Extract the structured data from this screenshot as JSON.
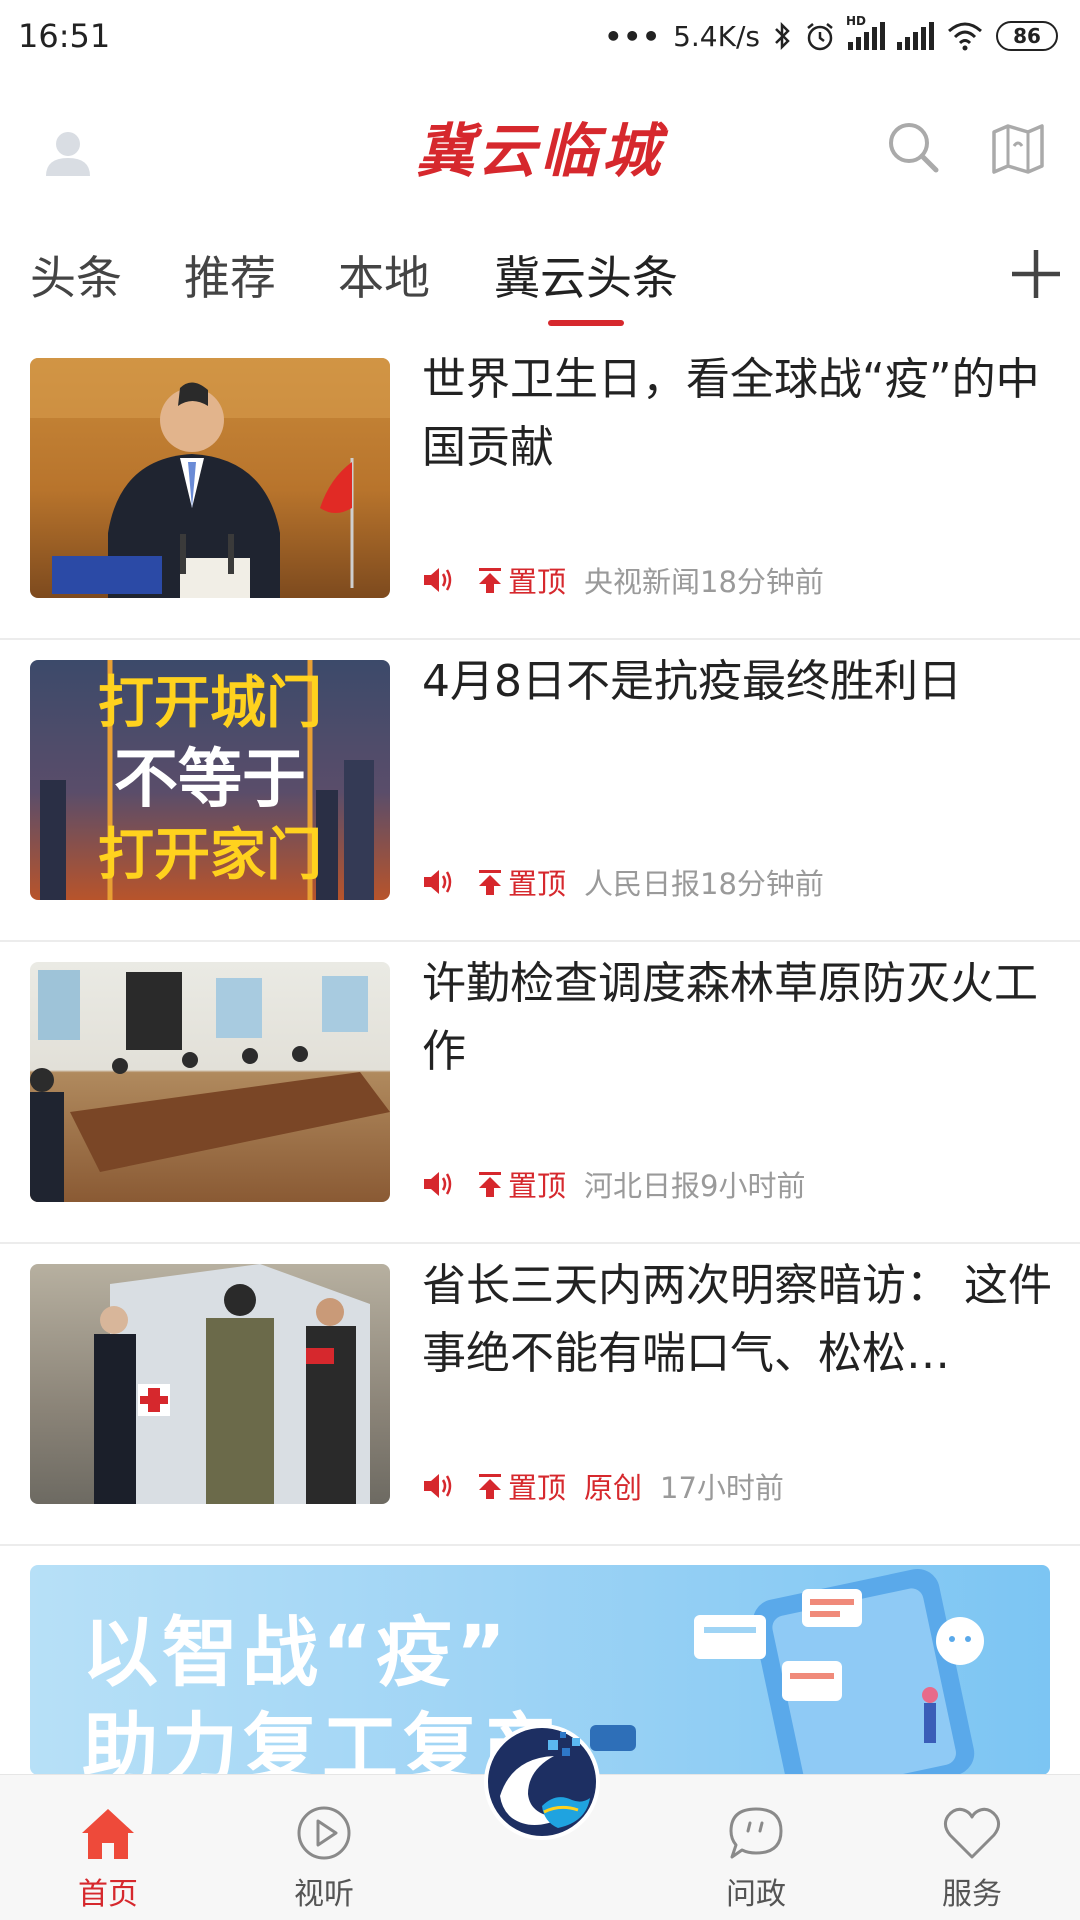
{
  "status_bar": {
    "time": "16:51",
    "network_speed": "5.4K/s",
    "hd_label": "HD",
    "battery": "86",
    "icons": [
      "dots-icon",
      "bluetooth-icon",
      "alarm-icon",
      "signal-icon",
      "signal-icon",
      "wifi-icon",
      "battery-icon"
    ]
  },
  "header": {
    "title": "冀云临城",
    "left_icon": "avatar-icon",
    "right_icons": [
      "search-icon",
      "map-icon"
    ]
  },
  "tabs": {
    "items": [
      {
        "label": "头条"
      },
      {
        "label": "推荐"
      },
      {
        "label": "本地"
      },
      {
        "label": "冀云头条"
      }
    ],
    "active_index": 3,
    "add_icon": "plus-icon"
  },
  "news": [
    {
      "title": "世界卫生日，看全球战“疫”的中国贡献",
      "pin_label": "置顶",
      "tag": "",
      "source": "央视新闻18分钟前"
    },
    {
      "title": "4月8日不是抗疫最终胜利日",
      "pin_label": "置顶",
      "tag": "",
      "source": "人民日报18分钟前",
      "image_text": [
        "打开城门",
        "不等于",
        "打开家门"
      ]
    },
    {
      "title": "许勤检查调度森林草原防灭火工作",
      "pin_label": "置顶",
      "tag": "",
      "source": "河北日报9小时前"
    },
    {
      "title": "省长三天内两次明察暗访： 这件事绝不能有喘口气、松松…",
      "pin_label": "置顶",
      "tag": "原创",
      "source": "17小时前"
    }
  ],
  "banner": {
    "line1": "以智战“疫”",
    "line2": "助力复工复产"
  },
  "bottom_nav": {
    "items": [
      {
        "label": "首页",
        "icon": "home-icon"
      },
      {
        "label": "视听",
        "icon": "play-icon"
      },
      {
        "label": "",
        "icon": "app-logo-icon"
      },
      {
        "label": "问政",
        "icon": "chat-icon"
      },
      {
        "label": "服务",
        "icon": "heart-icon"
      }
    ],
    "active_index": 0
  },
  "colors": {
    "accent": "#d6282d",
    "meta_gray": "#9a9a9a",
    "nav_background": "#f7f7f7"
  }
}
